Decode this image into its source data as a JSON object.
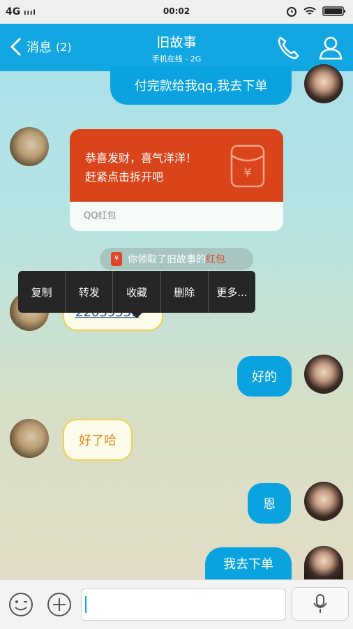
{
  "status_bar": {
    "network": "4G",
    "time": "00:02"
  },
  "header": {
    "back_label": "消息",
    "unread_count": "(2)",
    "title": "旧故事",
    "subtitle": "手机在线 - 2G"
  },
  "messages": {
    "m1": "付完款给我qq,我去下单",
    "redpacket_line1": "恭喜发财，喜气洋洋！",
    "redpacket_line2": "赶紧点击拆开吧",
    "redpacket_footer": "QQ红包",
    "notice_prefix": "你领取了旧故事的",
    "notice_highlight": "红包",
    "partial_text": "22039559",
    "m2": "好的",
    "m3": "好了哈",
    "m4": "恩",
    "m5": "我去下单"
  },
  "context_menu": {
    "copy": "复制",
    "forward": "转发",
    "favorite": "收藏",
    "delete": "删除",
    "more": "更多..."
  },
  "colors": {
    "header": "#12a7e3",
    "bubble_blue": "#0aa3e0",
    "redpacket": "#d9441b",
    "bubble_yellow_border": "#f1cf52"
  },
  "icons": [
    "back-arrow-icon",
    "phone-icon",
    "profile-icon",
    "emoji-icon",
    "plus-icon",
    "microphone-icon",
    "alarm-icon",
    "wifi-icon",
    "battery-icon",
    "red-packet-icon"
  ]
}
